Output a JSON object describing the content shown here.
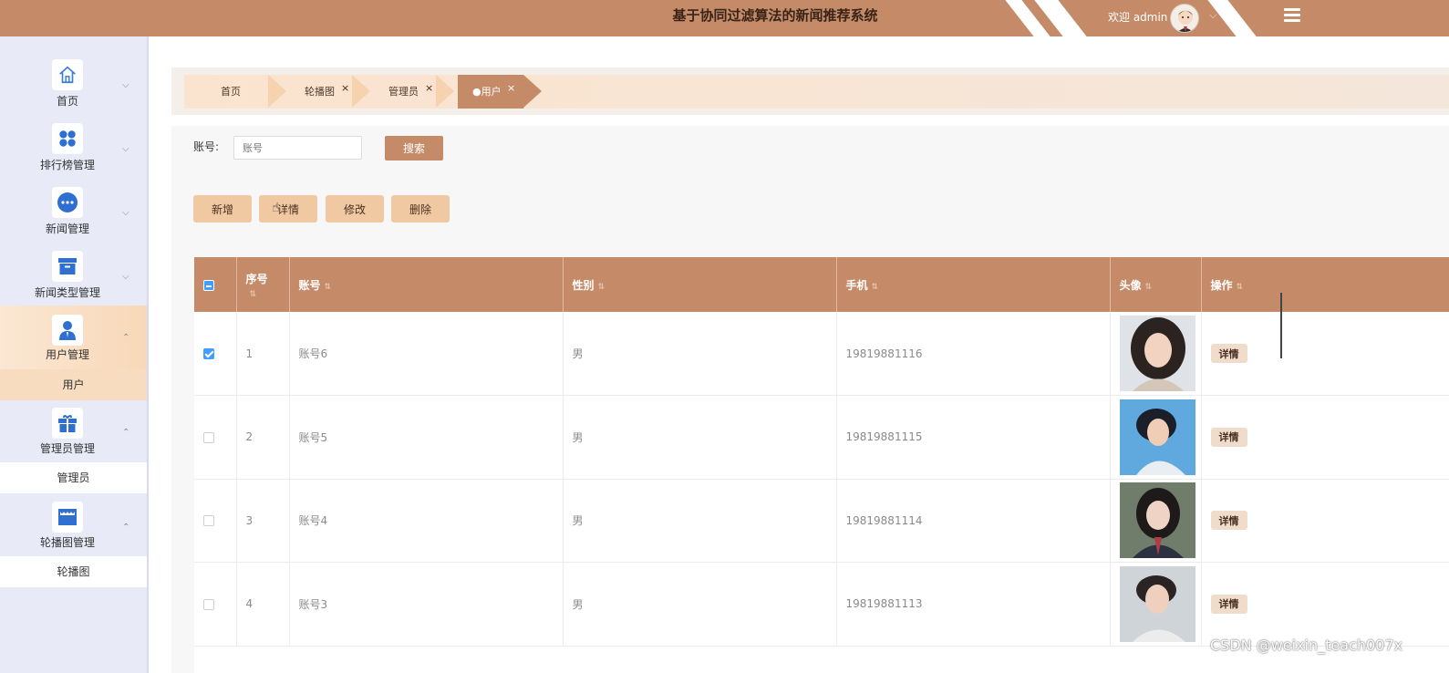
{
  "header": {
    "title": "基于协同过滤算法的新闻推荐系统",
    "welcome": "欢迎 admin",
    "avatar_icon": "user-avatar-icon",
    "dropdown_icon": "chevron-down-icon",
    "menu_icon": "hamburger-icon",
    "bg_color": "#c58b69"
  },
  "sidebar": {
    "items": [
      {
        "label": "首页",
        "icon": "home-icon"
      },
      {
        "label": "排行榜管理",
        "icon": "grid-icon"
      },
      {
        "label": "新闻管理",
        "icon": "more-circle-icon"
      },
      {
        "label": "新闻类型管理",
        "icon": "box-icon"
      },
      {
        "label": "用户管理",
        "icon": "user-icon"
      },
      {
        "label": "管理员管理",
        "icon": "gift-icon"
      },
      {
        "label": "轮播图管理",
        "icon": "shop-icon"
      }
    ],
    "sub_items": {
      "user": "用户",
      "admin": "管理员",
      "carousel": "轮播图"
    }
  },
  "tabs": [
    {
      "label": "首页"
    },
    {
      "label": "轮播图",
      "close": "×"
    },
    {
      "label": "管理员",
      "close": "×"
    },
    {
      "label": "●用户",
      "close": "×",
      "active": true
    }
  ],
  "search": {
    "label": "账号:",
    "placeholder": "账号",
    "button": "搜索"
  },
  "actions": {
    "add": "新增",
    "detail": "详情",
    "edit": "修改",
    "delete": "删除"
  },
  "table": {
    "columns": [
      "序号",
      "账号",
      "性别",
      "手机",
      "头像",
      "操作"
    ],
    "rows": [
      {
        "index": "1",
        "account": "账号6",
        "gender": "男",
        "phone": "19819881116",
        "action": "详情",
        "checked": true
      },
      {
        "index": "2",
        "account": "账号5",
        "gender": "男",
        "phone": "19819881115",
        "action": "详情",
        "checked": false
      },
      {
        "index": "3",
        "account": "账号4",
        "gender": "男",
        "phone": "19819881114",
        "action": "详情",
        "checked": false
      },
      {
        "index": "4",
        "account": "账号3",
        "gender": "男",
        "phone": "19819881113",
        "action": "详情",
        "checked": false
      }
    ]
  },
  "watermark": "CSDN @weixin_teach007x"
}
